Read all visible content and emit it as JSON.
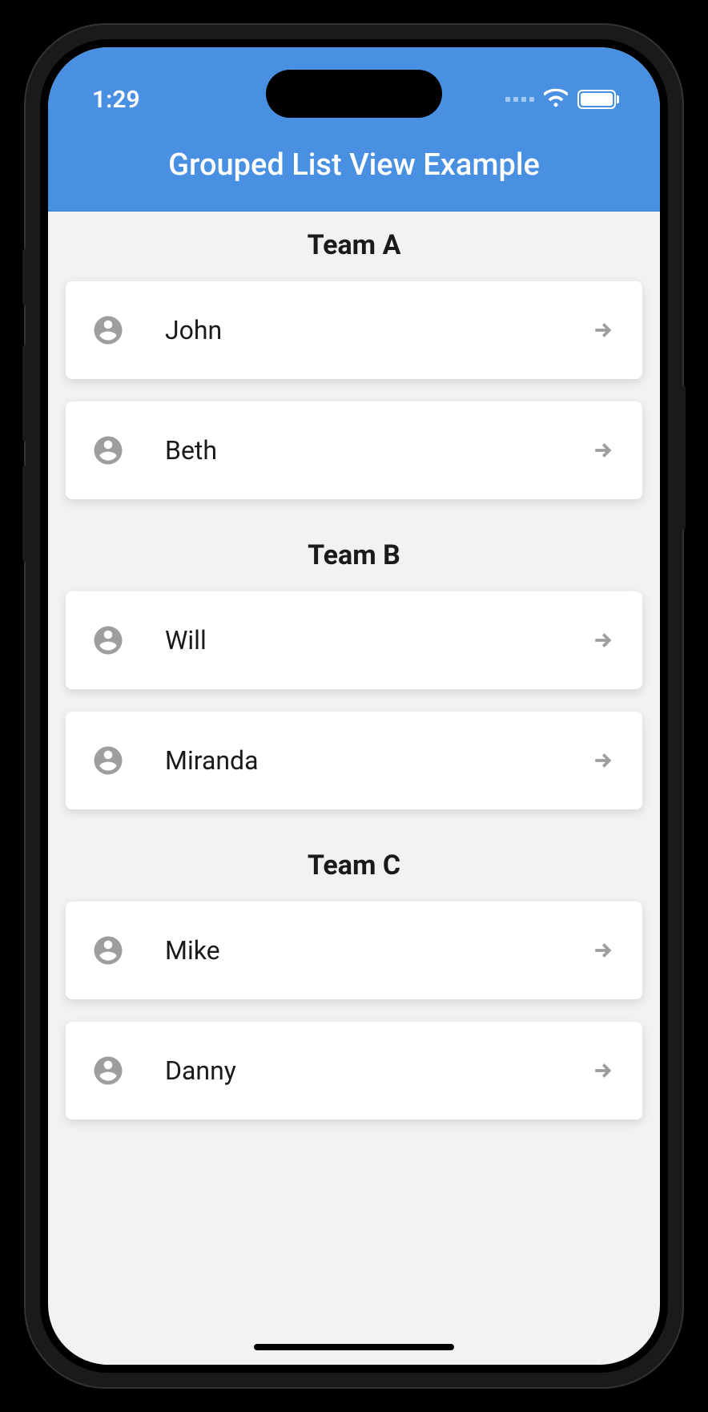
{
  "status": {
    "time": "1:29"
  },
  "header": {
    "title": "Grouped List View Example"
  },
  "groups": [
    {
      "title": "Team A",
      "members": [
        {
          "name": "John"
        },
        {
          "name": "Beth"
        }
      ]
    },
    {
      "title": "Team B",
      "members": [
        {
          "name": "Will"
        },
        {
          "name": "Miranda"
        }
      ]
    },
    {
      "title": "Team C",
      "members": [
        {
          "name": "Mike"
        },
        {
          "name": "Danny"
        }
      ]
    }
  ]
}
